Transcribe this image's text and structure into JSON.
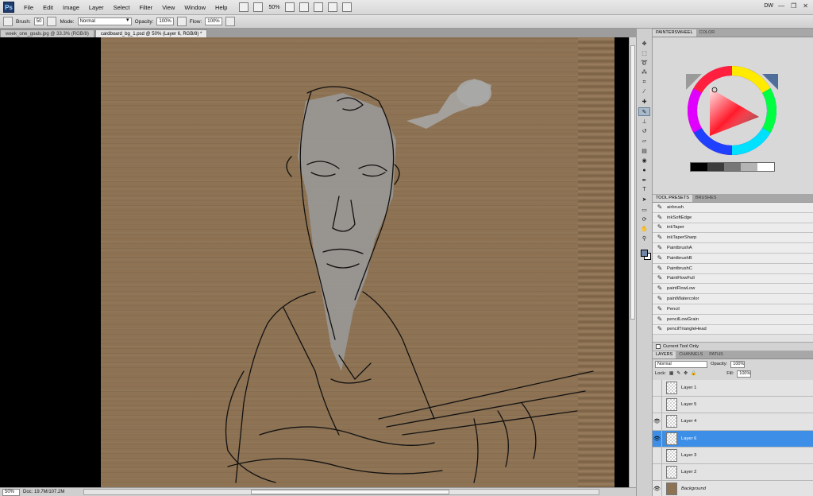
{
  "app": {
    "logo_text": "Ps",
    "menus": [
      "File",
      "Edit",
      "Image",
      "Layer",
      "Select",
      "Filter",
      "View",
      "Window",
      "Help"
    ],
    "zoom": "50%",
    "workspace": "DW"
  },
  "options_bar": {
    "brush_label": "Brush:",
    "brush_size": "50",
    "mode_label": "Mode:",
    "mode_value": "Normal",
    "opacity_label": "Opacity:",
    "opacity_value": "100%",
    "flow_label": "Flow:",
    "flow_value": "100%"
  },
  "documents": {
    "tabs": [
      {
        "label": "week_one_goals.jpg @ 33.3% (RGB/8)"
      },
      {
        "label": "cardboard_bg_1.psd @ 50% (Layer 6, RGB/8) *"
      }
    ]
  },
  "status": {
    "zoom": "50%",
    "doc_size": "Doc: 19.7M/107.2M"
  },
  "panels": {
    "color_tabs": [
      "PAINTERSWHEEL",
      "COLOR"
    ],
    "gray_ramp": [
      "#000000",
      "#3c3c3c",
      "#777777",
      "#b4b4b4",
      "#ffffff"
    ],
    "preset_tabs": [
      "TOOL PRESETS",
      "BRUSHES"
    ],
    "presets": [
      "airbrush",
      "inkSoftEdge",
      "inkTaper",
      "inkTaperSharp",
      "PaintbrushA",
      "PaintbrushB",
      "PaintbrushC",
      "PaintFlowFull",
      "paintFlowLow",
      "paintWatercolor",
      "Pencil",
      "pencilLowGrain",
      "pencilTriangleHead"
    ],
    "current_tool_only": "Current Tool Only",
    "layer_tabs": [
      "LAYERS",
      "CHANNELS",
      "PATHS"
    ],
    "blend_mode": "Normal",
    "opacity_label": "Opacity:",
    "opacity": "100%",
    "lock_label": "Lock:",
    "fill_label": "Fill:",
    "fill": "100%",
    "layers": [
      {
        "name": "Layer 1",
        "visible": false,
        "active": false
      },
      {
        "name": "Layer 5",
        "visible": false,
        "active": false
      },
      {
        "name": "Layer 4",
        "visible": true,
        "active": false
      },
      {
        "name": "Layer 6",
        "visible": true,
        "active": true
      },
      {
        "name": "Layer 3",
        "visible": false,
        "active": false
      },
      {
        "name": "Layer 2",
        "visible": false,
        "active": false
      },
      {
        "name": "Background",
        "visible": true,
        "active": false
      }
    ]
  }
}
